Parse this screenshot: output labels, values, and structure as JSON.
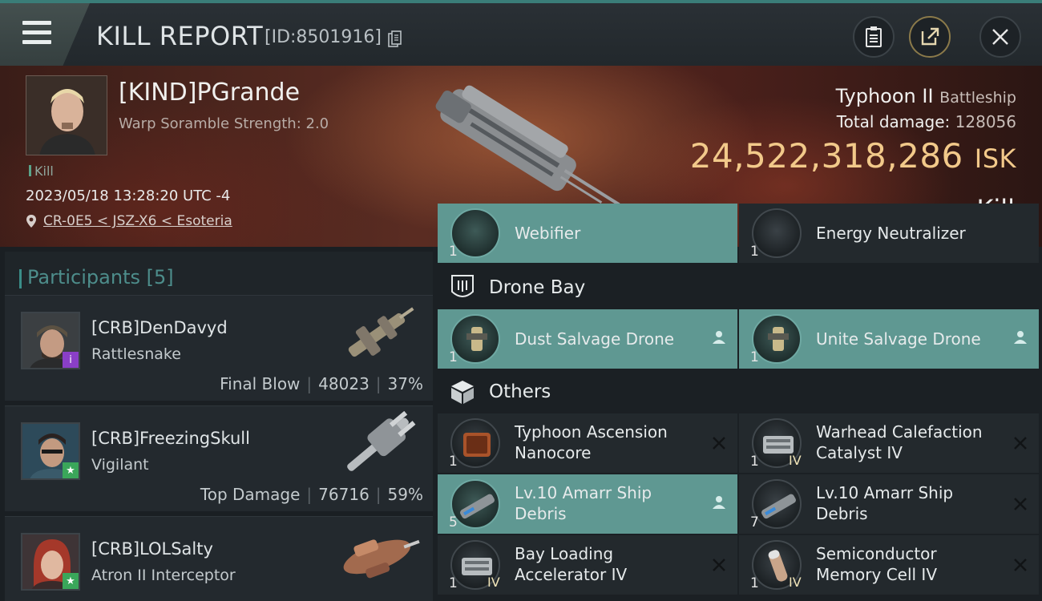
{
  "header": {
    "title": "KILL REPORT",
    "report_id": "[ID:8501916]"
  },
  "victim": {
    "name": "[KIND]PGrande",
    "warp_scramble": "Warp Soramble Strength: 2.0",
    "tag": "Kill",
    "datetime": "2023/05/18 13:28:20 UTC -4",
    "location": "CR-0E5 < JSZ-X6 < Esoteria",
    "ship_name": "Typhoon II",
    "ship_class": "Battleship",
    "total_damage_label": "Total damage:",
    "total_damage": "128056",
    "isk_value": "24,522,318,286",
    "isk_unit": "ISK",
    "result": "Kill"
  },
  "participants": {
    "label": "Participants",
    "count": "[5]",
    "rows": [
      {
        "name": "[CRB]DenDavyd",
        "ship": "Rattlesnake",
        "stat_label": "Final Blow",
        "damage": "48023",
        "percent": "37%",
        "badge": "i",
        "badge_color": "#8a3fc7"
      },
      {
        "name": "[CRB]FreezingSkull",
        "ship": "Vigilant",
        "stat_label": "Top Damage",
        "damage": "76716",
        "percent": "59%",
        "badge": "★",
        "badge_color": "#3aa65a"
      },
      {
        "name": "[CRB]LOLSalty",
        "ship": "Atron II Interceptor",
        "stat_label": "",
        "damage": "",
        "percent": "",
        "badge": "★",
        "badge_color": "#3aa65a"
      }
    ]
  },
  "items": {
    "partial_top": [
      {
        "qty": "1",
        "name": "Webifier"
      },
      {
        "qty": "1",
        "name": "Energy Neutralizer"
      }
    ],
    "drone_bay": {
      "title": "Drone Bay",
      "cells": [
        {
          "qty": "1",
          "name": "Dust Salvage Drone",
          "state": "dropped"
        },
        {
          "qty": "1",
          "name": "Unite Salvage Drone",
          "state": "dropped"
        }
      ]
    },
    "others": {
      "title": "Others",
      "cells": [
        {
          "qty": "1",
          "name_l1": "Typhoon Ascension",
          "name_l2": "Nanocore",
          "level": "",
          "state": "destroyed"
        },
        {
          "qty": "1",
          "name_l1": "Warhead Calefaction",
          "name_l2": "Catalyst IV",
          "level": "IV",
          "state": "destroyed"
        },
        {
          "qty": "5",
          "name_l1": "Lv.10 Amarr Ship",
          "name_l2": "Debris",
          "level": "",
          "state": "dropped"
        },
        {
          "qty": "7",
          "name_l1": "Lv.10 Amarr Ship",
          "name_l2": "Debris",
          "level": "",
          "state": "destroyed"
        },
        {
          "qty": "1",
          "name_l1": "Bay Loading",
          "name_l2": "Accelerator IV",
          "level": "IV",
          "state": "destroyed"
        },
        {
          "qty": "1",
          "name_l1": "Semiconductor",
          "name_l2": "Memory Cell IV",
          "level": "IV",
          "state": "destroyed"
        }
      ]
    }
  },
  "icons": {
    "dropped": "person-icon",
    "destroyed": "x-icon"
  },
  "colors": {
    "accent": "#3a8d88",
    "highlight": "#5f9892",
    "isk": "#f2c98a"
  }
}
